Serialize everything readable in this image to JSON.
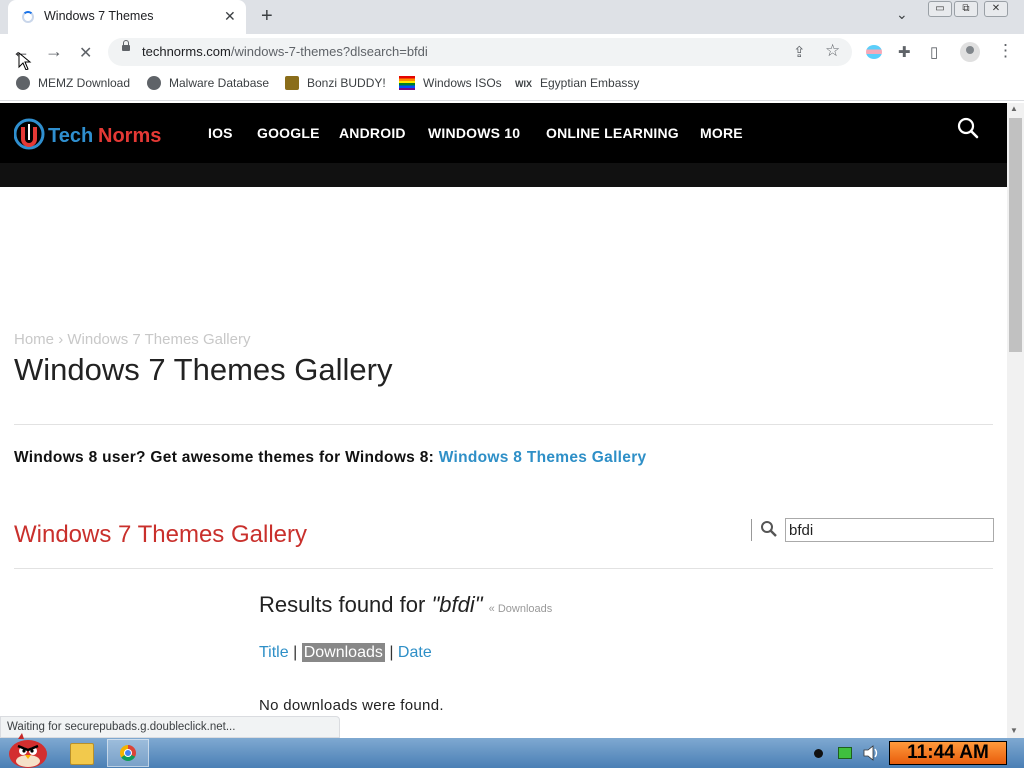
{
  "browser": {
    "tab": {
      "title": "Windows 7 Themes",
      "close": "✕"
    },
    "new_tab": "+",
    "tab_search": "⌄",
    "window_controls": {
      "minimize": "▭",
      "restore": "⧉",
      "close": "✕"
    },
    "nav": {
      "back": "←",
      "forward": "→",
      "stop": "✕"
    },
    "address": {
      "domain": "technorms.com",
      "path": "/windows-7-themes?dlsearch=bfdi"
    },
    "toolbar_icons": {
      "share": "⇪",
      "star": "☆",
      "extensions": "✚",
      "sidepanel": "▯",
      "profile": "●",
      "menu": "⋮"
    },
    "bookmarks": [
      {
        "label": "MEMZ Download",
        "icon": "globe-icon"
      },
      {
        "label": "Malware Database",
        "icon": "globe-icon"
      },
      {
        "label": "Bonzi BUDDY!",
        "icon": "bonzi-icon"
      },
      {
        "label": "Windows ISOs",
        "icon": "rainbow-flag-icon"
      },
      {
        "label": "Egyptian Embassy",
        "icon": "wix-icon"
      }
    ],
    "wix_text": "WIX",
    "status_text": "Waiting for securepubads.g.doubleclick.net..."
  },
  "site": {
    "nav_items": [
      "IOS",
      "GOOGLE",
      "ANDROID",
      "WINDOWS 10",
      "ONLINE LEARNING",
      "MORE"
    ],
    "breadcrumb": {
      "home": "Home",
      "sep": "›",
      "current": "Windows 7 Themes Gallery"
    },
    "page_title": "Windows 7 Themes Gallery",
    "promo": {
      "text": "Windows 8 user? Get awesome themes for Windows 8:",
      "link": "Windows 8 Themes Gallery"
    },
    "section_title": "Windows 7 Themes Gallery",
    "search": {
      "value": "bfdi"
    },
    "results": {
      "prefix": "Results found for",
      "query": "\"bfdi\"",
      "downloads_link": "« Downloads"
    },
    "sort": {
      "title": "Title",
      "sep1": "|",
      "downloads": "Downloads",
      "sep2": "|",
      "date": "Date"
    },
    "no_results": "No downloads were found."
  },
  "taskbar": {
    "clock": "11:44 AM"
  },
  "colors": {
    "accent_red": "#c9302c",
    "link_blue": "#2e8fc7",
    "header_black": "#000000"
  }
}
